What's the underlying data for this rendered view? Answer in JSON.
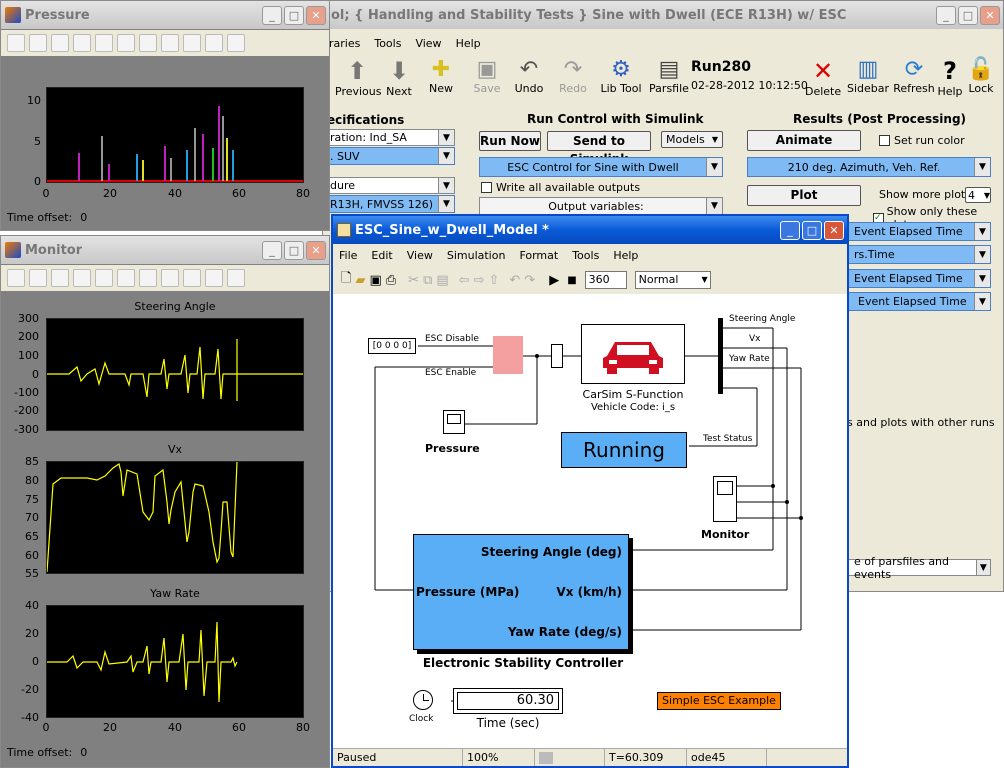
{
  "pressure": {
    "title": "Pressure",
    "time_offset_label": "Time offset:",
    "time_offset_value": "0",
    "y_ticks": [
      "10",
      "5",
      "0"
    ],
    "x_ticks": [
      "0",
      "20",
      "40",
      "60",
      "80"
    ]
  },
  "monitor": {
    "title": "Monitor",
    "time_offset_label": "Time offset:",
    "time_offset_value": "0",
    "plots": [
      {
        "title": "Steering Angle",
        "y_ticks": [
          "300",
          "200",
          "100",
          "0",
          "-100",
          "-200",
          "-300"
        ]
      },
      {
        "title": "Vx",
        "y_ticks": [
          "85",
          "80",
          "75",
          "70",
          "65",
          "60",
          "55"
        ]
      },
      {
        "title": "Yaw Rate",
        "y_ticks": [
          "40",
          "20",
          "0",
          "-20",
          "-40"
        ]
      }
    ],
    "x_ticks": [
      "0",
      "20",
      "40",
      "60",
      "80"
    ]
  },
  "carsim": {
    "title": "ol;  { Handling and Stability Tests }  Sine with Dwell (ECE R13H) w/ ESC",
    "menu": [
      "raries",
      "Tools",
      "View",
      "Help"
    ],
    "toolbar": [
      "Previous",
      "Next",
      "New",
      "Save",
      "Undo",
      "Redo",
      "Lib Tool",
      "Parsfile",
      "Delete",
      "Sidebar",
      "Refresh",
      "Help",
      "Lock"
    ],
    "run_name": "Run280",
    "run_date": "02-28-2012 10:12:50",
    "spec_header": "ecifications",
    "spec_items": [
      "ration: Ind_SA",
      ". SUV",
      "dure",
      "R13H, FMVSS 126)"
    ],
    "run_control_header": "Run Control with Simulink",
    "run_now": "Run Now",
    "send_to_simulink": "Send to Simulink",
    "models": "Models",
    "esc_control": "ESC Control for Sine with Dwell",
    "write_all": "Write all available outputs",
    "output_vars": "Output variables:",
    "results_header": "Results (Post Processing)",
    "animate": "Animate",
    "set_run_color": "Set run color",
    "azimuth": "210 deg. Azimuth, Veh. Ref.",
    "plot": "Plot",
    "show_more_plots": "Show more plots:",
    "show_more_value": "4",
    "show_only": "Show only these plots",
    "plot_dds": [
      "Event Elapsed Time",
      "rs.Time",
      "Event Elapsed Time",
      "Event Elapsed Time"
    ],
    "other_runs": "s and plots with other runs",
    "parsfiles": "e of parsfiles and events"
  },
  "simulink": {
    "title": "ESC_Sine_w_Dwell_Model *",
    "menu": [
      "File",
      "Edit",
      "View",
      "Simulation",
      "Format",
      "Tools",
      "Help"
    ],
    "stop_time": "360",
    "mode": "Normal",
    "const_block": "[0 0 0 0]",
    "esc_disable": "ESC Disable",
    "esc_enable": "ESC Enable",
    "carsim_block_label": "CarSim S-Function",
    "vehicle_code": "Vehicle Code: i_s",
    "bus_labels": [
      "Steering Angle",
      "Vx",
      "Yaw Rate"
    ],
    "test_status": "Test Status",
    "running": "Running",
    "pressure_scope": "Pressure",
    "monitor_scope": "Monitor",
    "controller_in": [
      "Steering Angle (deg)",
      "Vx (km/h)",
      "Yaw Rate (deg/s)"
    ],
    "controller_out": "Pressure (MPa)",
    "controller_name": "Electronic Stability Controller",
    "clock": "Clock",
    "time_value": "60.30",
    "time_label": "Time (sec)",
    "example_label": "Simple ESC Example",
    "status": [
      "Paused",
      "100%",
      "",
      "T=60.309",
      "ode45"
    ]
  },
  "colors": {
    "running": "#5aaef5",
    "orange": "#ff8000",
    "blue_dd": "#7fbaf4"
  }
}
